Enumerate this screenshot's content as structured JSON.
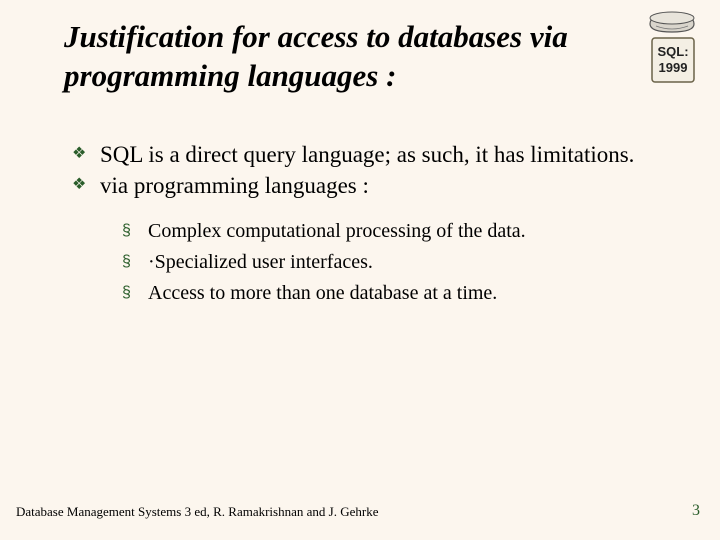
{
  "title": "Justification for access to databases via programming languages :",
  "logo": {
    "label_line1": "SQL:",
    "label_line2": "1999"
  },
  "bullets": [
    "SQL is a direct query language; as such, it has limitations.",
    "via programming languages :"
  ],
  "subbullets": [
    "Complex computational processing of the data.",
    "·Specialized user interfaces.",
    "Access to more than one database at a time."
  ],
  "footer": "Database Management Systems 3 ed,  R. Ramakrishnan and J. Gehrke",
  "page_number": "3"
}
